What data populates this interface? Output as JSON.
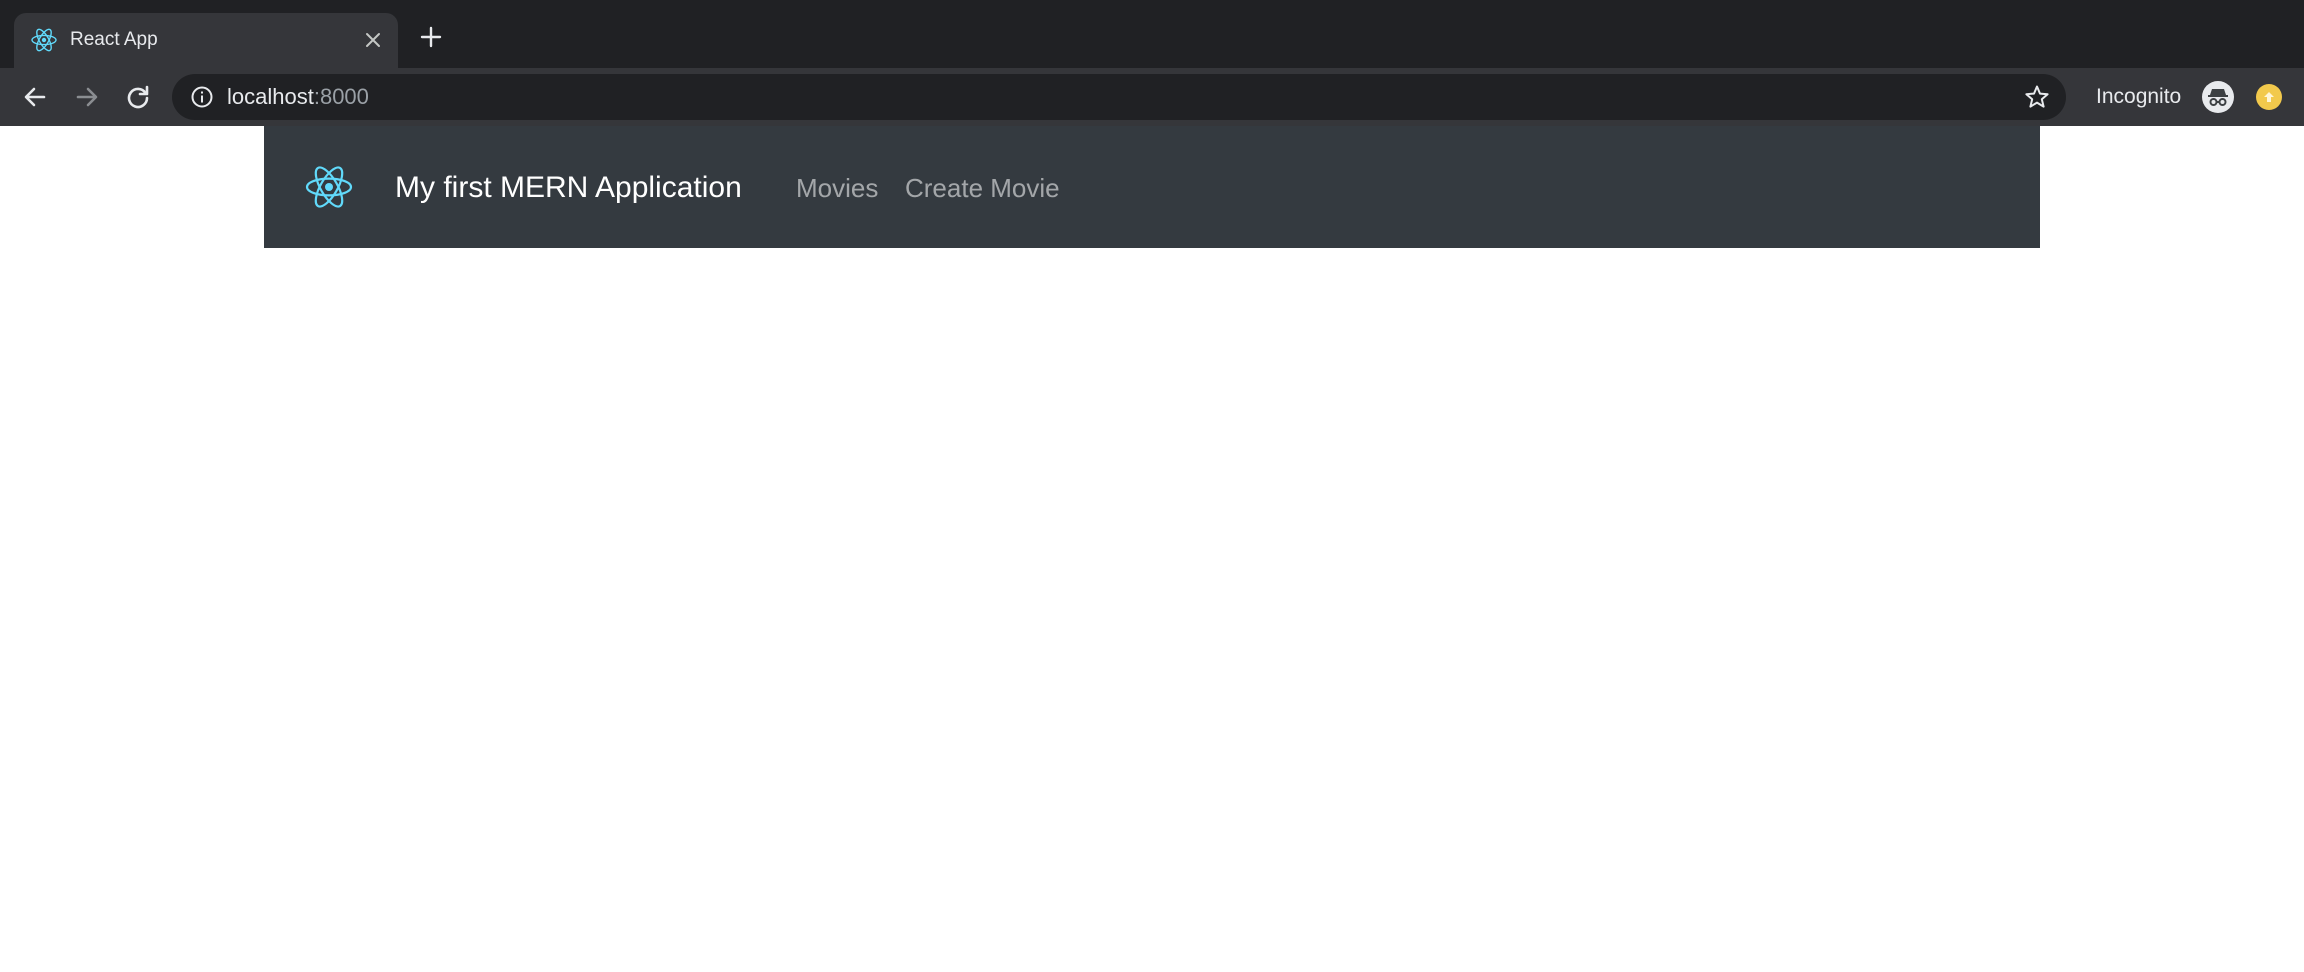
{
  "browser": {
    "tab": {
      "title": "React App",
      "favicon": "react-atom-icon",
      "close_icon": "close-icon"
    },
    "new_tab_icon": "plus-icon",
    "nav": {
      "back_icon": "arrow-left-icon",
      "forward_icon": "arrow-right-icon",
      "reload_icon": "reload-icon"
    },
    "address": {
      "host": "localhost",
      "port": ":8000",
      "info_icon": "info-icon",
      "bookmark_icon": "star-icon"
    },
    "incognito_label": "Incognito",
    "colors": {
      "frame": "#202124",
      "toolbar": "#35363a",
      "omnibox": "#202124",
      "text": "#e8eaed",
      "profile": "#f2c94c"
    }
  },
  "navbar": {
    "brand_title": "My first MERN Application",
    "logo": "react-atom-icon",
    "links": [
      "Movies",
      "Create Movie"
    ],
    "colors": {
      "background": "#343a40",
      "brand": "#ffffff",
      "link": "rgba(255,255,255,0.55)",
      "logo": "#61dafb"
    }
  }
}
